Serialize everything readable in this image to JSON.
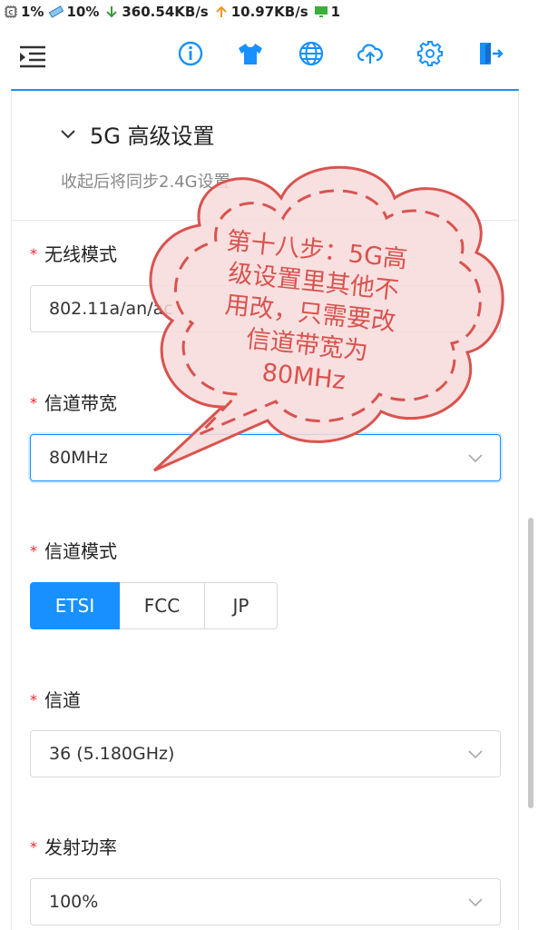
{
  "status_bar": {
    "cpu": "1%",
    "mem": "10%",
    "down": "360.54KB/s",
    "up": "10.97KB/s",
    "screen": "1"
  },
  "toolbar": {
    "icons": [
      "menu-icon",
      "info-icon",
      "shirt-icon",
      "globe-icon",
      "upload-cloud-icon",
      "gear-icon",
      "logout-icon"
    ]
  },
  "section": {
    "title": "5G 高级设置",
    "subtitle": "收起后将同步2.4G设置"
  },
  "form": {
    "wireless_mode": {
      "label": "无线模式",
      "value": "802.11a/an/ac"
    },
    "bandwidth": {
      "label": "信道带宽",
      "value": "80MHz"
    },
    "channel_mode": {
      "label": "信道模式",
      "options": [
        "ETSI",
        "FCC",
        "JP"
      ],
      "selected": "ETSI"
    },
    "channel": {
      "label": "信道",
      "value": "36 (5.180GHz)"
    },
    "tx_power": {
      "label": "发射功率",
      "value": "100%"
    }
  },
  "callout": {
    "lines": [
      "第十八步：5G高",
      "级设置里其他不",
      "用改，只需要改",
      "信道带宽为",
      "80MHz"
    ]
  },
  "colors": {
    "accent": "#1890ff",
    "required": "#f5222d",
    "callout": "#d9534f"
  }
}
